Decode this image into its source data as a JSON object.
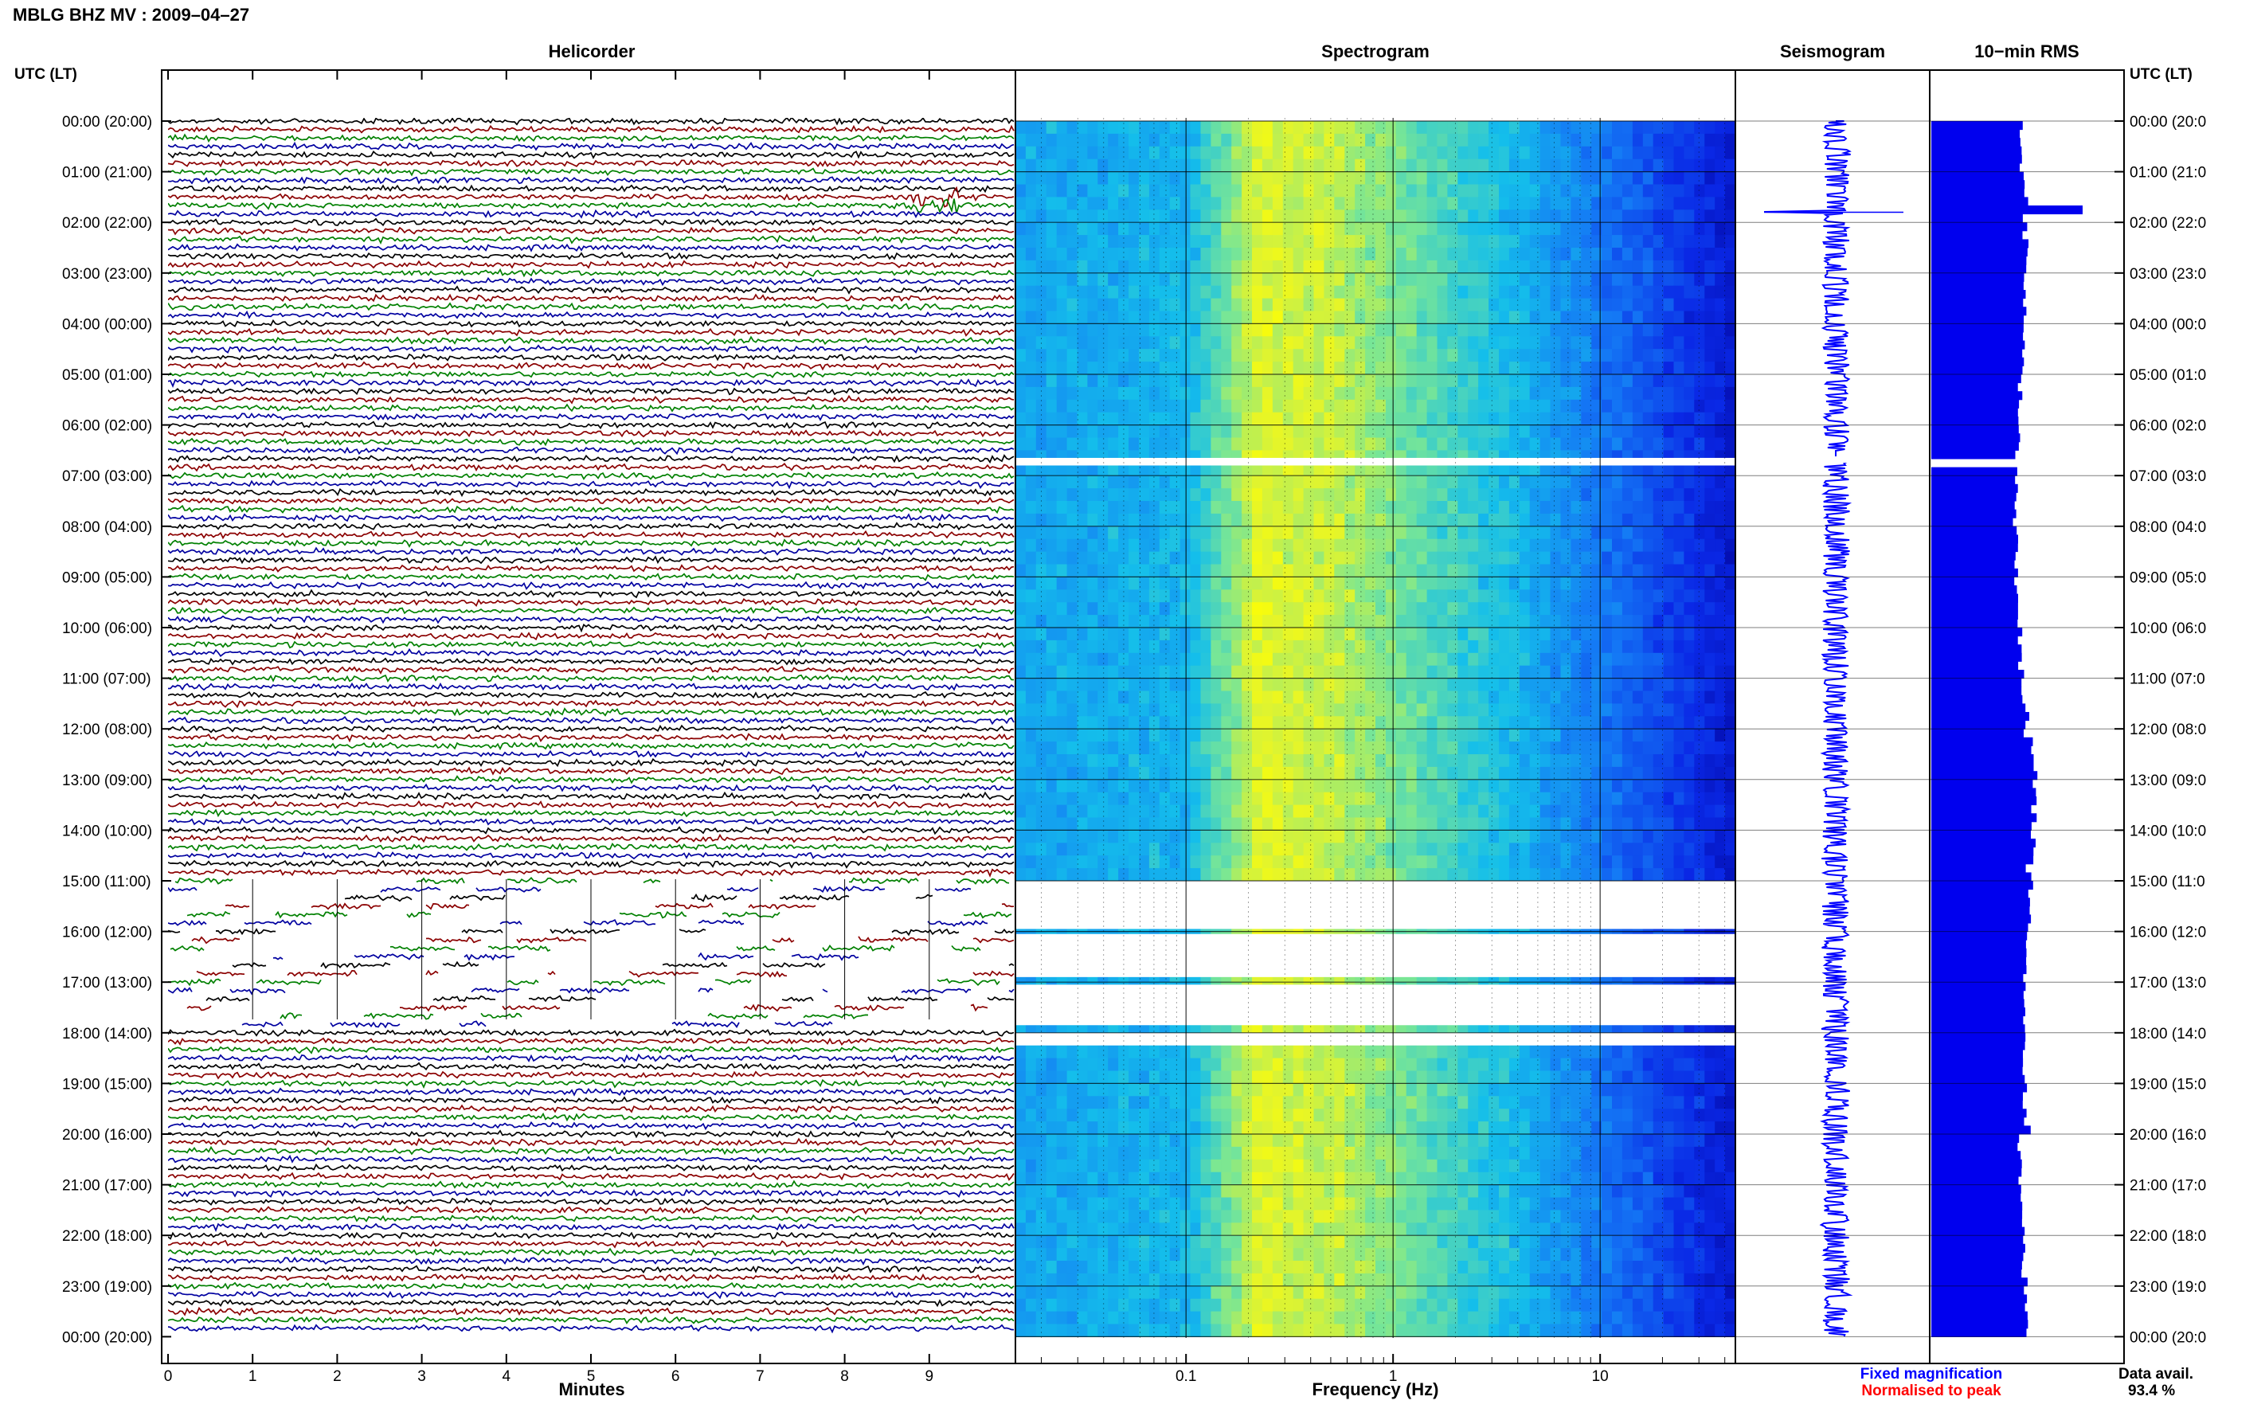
{
  "header": {
    "title": "MBLG BHZ MV : 2009–04–27"
  },
  "time_axis": {
    "left_label": "UTC (LT)",
    "right_label": "UTC (LT)",
    "hours": [
      "00:00 (20:00)",
      "01:00 (21:00)",
      "02:00 (22:00)",
      "03:00 (23:00)",
      "04:00 (00:00)",
      "05:00 (01:00)",
      "06:00 (02:00)",
      "07:00 (03:00)",
      "08:00 (04:00)",
      "09:00 (05:00)",
      "10:00 (06:00)",
      "11:00 (07:00)",
      "12:00 (08:00)",
      "13:00 (09:00)",
      "14:00 (10:00)",
      "15:00 (11:00)",
      "16:00 (12:00)",
      "17:00 (13:00)",
      "18:00 (14:00)",
      "19:00 (15:00)",
      "20:00 (16:00)",
      "21:00 (17:00)",
      "22:00 (18:00)",
      "23:00 (19:00)",
      "00:00 (20:00)"
    ],
    "right_hours": [
      "00:00 (20:0",
      "01:00 (21:0",
      "02:00 (22:0",
      "03:00 (23:0",
      "04:00 (00:0",
      "05:00 (01:0",
      "06:00 (02:0",
      "07:00 (03:0",
      "08:00 (04:0",
      "09:00 (05:0",
      "10:00 (06:0",
      "11:00 (07:0",
      "12:00 (08:0",
      "13:00 (09:0",
      "14:00 (10:0",
      "15:00 (11:0",
      "16:00 (12:0",
      "17:00 (13:0",
      "18:00 (14:0",
      "19:00 (15:0",
      "20:00 (16:0",
      "21:00 (17:0",
      "22:00 (18:0",
      "23:00 (19:0",
      "00:00 (20:0"
    ]
  },
  "chart_data": [
    {
      "type": "line",
      "title": "Helicorder",
      "xlabel": "Minutes",
      "xlim": [
        0,
        10
      ],
      "xticks": [
        "0",
        "1",
        "2",
        "3",
        "4",
        "5",
        "6",
        "7",
        "8",
        "9"
      ],
      "trace_colors": [
        "#000000",
        "#8b0000",
        "#008000",
        "#0000a0"
      ],
      "traces_per_hour": 6,
      "gap_hours_utc": [
        15,
        18
      ],
      "events": [
        {
          "hour_utc": 1.6,
          "minute": 9.1,
          "label": ""
        }
      ]
    },
    {
      "type": "heatmap",
      "title": "Spectrogram",
      "xlabel": "Frequency (Hz)",
      "xscale": "log",
      "xlim": [
        0.015,
        45
      ],
      "xticks": [
        "0.1",
        "1",
        "10"
      ],
      "gap_hours_utc": [
        [
          6.65,
          6.8
        ],
        [
          15.0,
          15.95
        ],
        [
          16.05,
          16.9
        ],
        [
          17.05,
          17.85
        ],
        [
          18.0,
          18.25
        ]
      ]
    },
    {
      "type": "line",
      "title": "Seismogram",
      "legend": [
        {
          "label": "Fixed magnification",
          "color": "#0000ff"
        },
        {
          "label": "Normalised to peak",
          "color": "#ff0000"
        }
      ]
    },
    {
      "type": "bar",
      "title": "10−min RMS",
      "orientation": "horizontal",
      "footer_label": "Data avail.",
      "footer_value": "93.4 %"
    }
  ]
}
